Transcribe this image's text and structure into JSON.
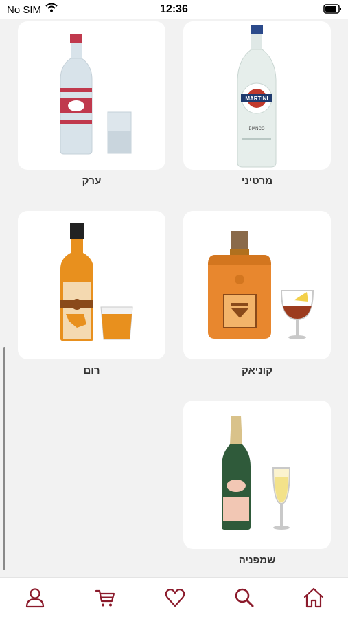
{
  "status_bar": {
    "carrier": "No SIM",
    "time": "12:36"
  },
  "categories": [
    {
      "label": "מרטיני",
      "icon": "martini-bottle-icon"
    },
    {
      "label": "ערק",
      "icon": "arak-bottle-icon"
    },
    {
      "label": "קוניאק",
      "icon": "cognac-bottle-icon"
    },
    {
      "label": "רום",
      "icon": "rum-bottle-icon"
    },
    {
      "label": "שמפניה",
      "icon": "champagne-bottle-icon"
    }
  ],
  "martini_label": {
    "brand": "MARTINI",
    "variant": "BIANCO"
  },
  "tab_bar": {
    "items": [
      "user-icon",
      "cart-icon",
      "heart-icon",
      "search-icon",
      "home-icon"
    ],
    "color": "#8b1a2b"
  }
}
